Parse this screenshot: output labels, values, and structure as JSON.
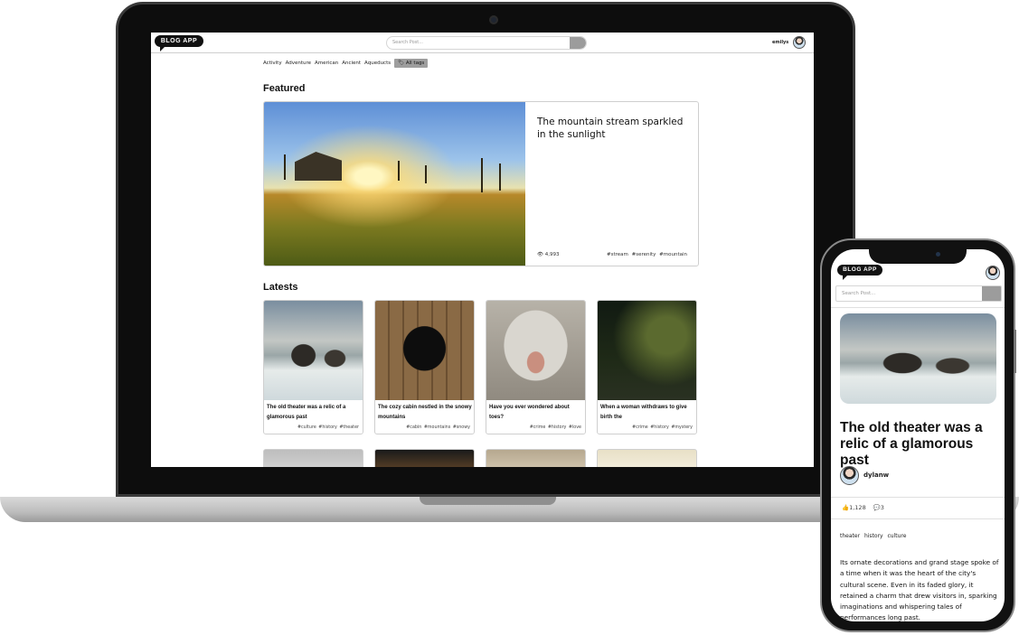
{
  "app": {
    "logo": "BLOG APP"
  },
  "laptop": {
    "search_placeholder": "Search Post...",
    "search_icon": "search-icon",
    "username": "emilys",
    "tags": [
      "Activity",
      "Adventure",
      "American",
      "Ancient",
      "Aqueducts"
    ],
    "all_tags_label": "All tags",
    "featured": {
      "heading": "Featured",
      "title": "The mountain stream sparkled in the sunlight",
      "views": "4,993",
      "tags": "#stream #serenity #mountain"
    },
    "latest": {
      "heading": "Latests",
      "cards": [
        {
          "title": "The old theater was a relic of a glamorous past",
          "tags": "#culture #history #theater"
        },
        {
          "title": "The cozy cabin nestled in the snowy mountains",
          "tags": "#cabin #mountains #snowy"
        },
        {
          "title": "Have you ever wondered about toes?",
          "tags": "#crime #history #love"
        },
        {
          "title": "When a woman withdraws to give birth the",
          "tags": "#crime #history #mystery"
        }
      ]
    }
  },
  "phone": {
    "search_placeholder": "Search Post...",
    "post": {
      "title": "The old theater was a relic of a glamorous past",
      "author": "dylanw",
      "likes": "1,128",
      "comments": "3",
      "tags": "theater history culture",
      "body": "Its ornate decorations and grand stage spoke of a time when it was the heart of the city's cultural scene. Even in its faded glory, it retained a charm that drew visitors in, sparking imaginations and whispering tales of performances long past."
    }
  }
}
